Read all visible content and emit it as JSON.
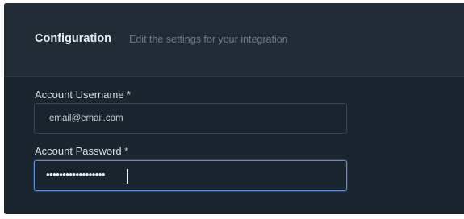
{
  "config": {
    "title": "Configuration",
    "subtitle": "Edit the settings for your integration"
  },
  "fields": {
    "username": {
      "label": "Account Username *",
      "value": "email@email.com"
    },
    "password": {
      "label": "Account Password *",
      "value": "••••••••••••••••••"
    }
  },
  "colors": {
    "panel_background": "#1b2530",
    "header_background": "#212c37",
    "focus_border": "#5d8fd6"
  }
}
